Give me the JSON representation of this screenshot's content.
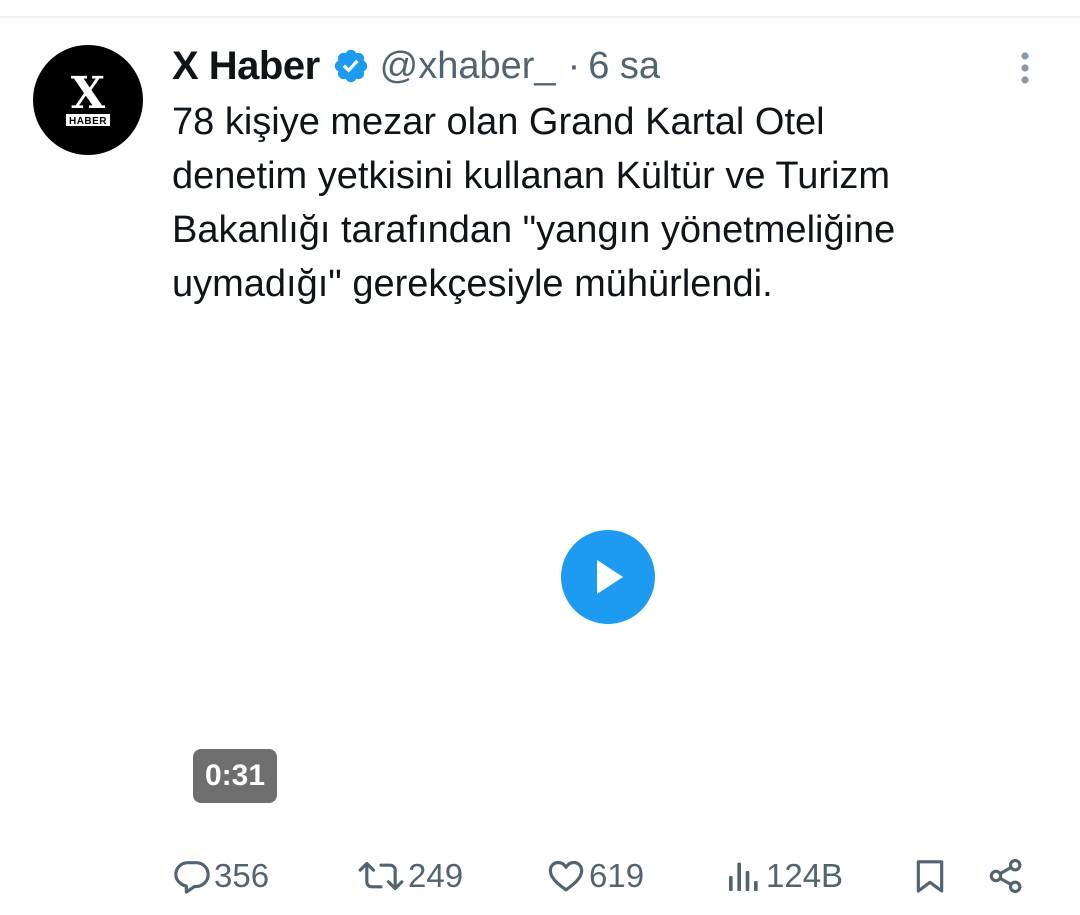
{
  "tweet": {
    "avatar": {
      "logo_letter": "X",
      "logo_word": "HABER"
    },
    "display_name": "X Haber",
    "handle": "@xhaber_",
    "separator": "·",
    "time": "6 sa",
    "text": "78 kişiye mezar olan Grand Kartal Otel\ndenetim yetkisini kullanan Kültür ve Turizm\nBakanlığı tarafından \"yangın yönetmeliğine\nuymadığı\" gerekçesiyle mühürlendi.",
    "media": {
      "type": "video",
      "duration": "0:31"
    },
    "stats": {
      "replies": "356",
      "reposts": "249",
      "likes": "619",
      "views": "124B"
    }
  },
  "icons": {
    "verified": "verified-badge-icon",
    "more": "more-vertical-icon",
    "reply": "reply-icon",
    "repost": "repost-icon",
    "like": "heart-icon",
    "views": "views-icon",
    "bookmark": "bookmark-icon",
    "share": "share-icon",
    "play": "play-icon"
  },
  "colors": {
    "accent": "#1d9bf0",
    "text_primary": "#0f1419",
    "text_secondary": "#536471",
    "duration_badge": "#6e6e6e"
  }
}
